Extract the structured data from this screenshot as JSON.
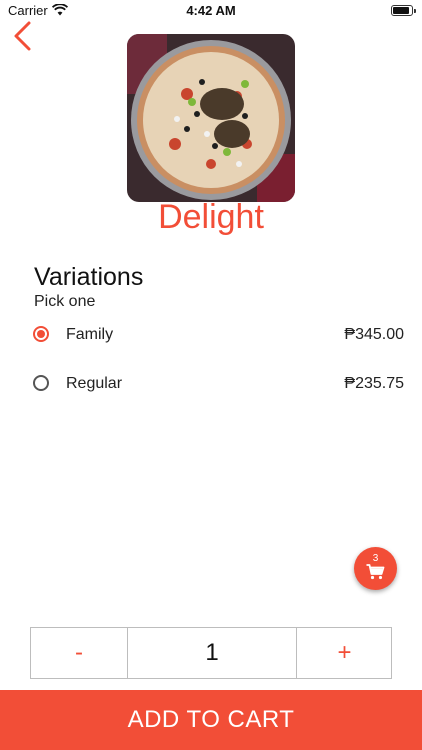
{
  "status_bar": {
    "carrier": "Carrier",
    "time": "4:42 AM"
  },
  "product": {
    "name": "Delight",
    "image_icon": "pizza-photo"
  },
  "variations": {
    "title": "Variations",
    "subtitle": "Pick one",
    "options": [
      {
        "label": "Family",
        "price": "₱345.00",
        "selected": true
      },
      {
        "label": "Regular",
        "price": "₱235.75",
        "selected": false
      }
    ]
  },
  "cart": {
    "count": "3"
  },
  "quantity": {
    "minus": "-",
    "value": "1",
    "plus": "+"
  },
  "actions": {
    "add_to_cart": "ADD TO CART"
  },
  "colors": {
    "accent": "#f24e37"
  }
}
